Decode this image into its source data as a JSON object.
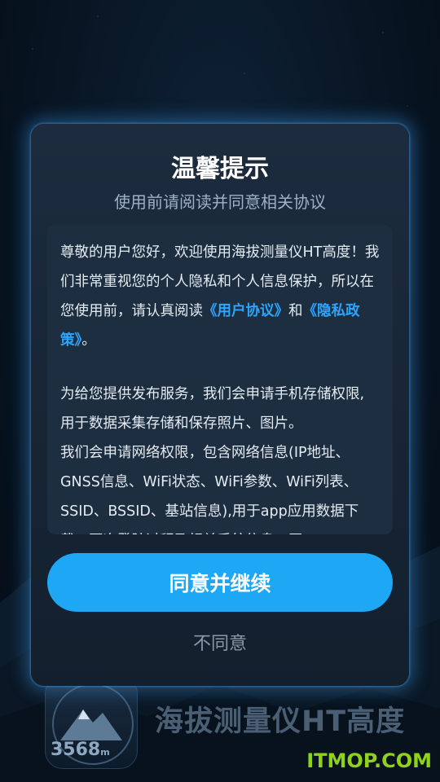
{
  "dialog": {
    "title": "温馨提示",
    "subtitle": "使用前请阅读并同意相关协议",
    "para1_prefix": "尊敬的用户您好，欢迎使用海拔测量仪HT高度！我们非常重视您的个人隐私和个人信息保护，所以在您使用前，请认真阅读",
    "user_agreement_link": "《用户协议》",
    "para1_and": "和",
    "privacy_policy_link": "《隐私政策》",
    "para1_suffix": "。",
    "para2": "为给您提供发布服务，我们会申请手机存储权限, 用于数据采集存储和保存照片、图片。",
    "para3": "我们会申请网络权限，包含网络信息(IP地址、GNSS信息、WiFi状态、WiFi参数、WiFi列表、SSID、BSSID、基站信息),用于app应用数据下载，再次登陆过程及相关系统信息，同",
    "agree_label": "同意并继续",
    "disagree_label": "不同意"
  },
  "background": {
    "app_name": "海拔测量仪HT高度",
    "app_icon_value": "3568",
    "app_icon_unit": "m"
  },
  "watermark": "ITMOP.COM",
  "colors": {
    "accent": "#1da7f5",
    "link": "#2ba6ff",
    "dialog_bg": "#17263a"
  }
}
